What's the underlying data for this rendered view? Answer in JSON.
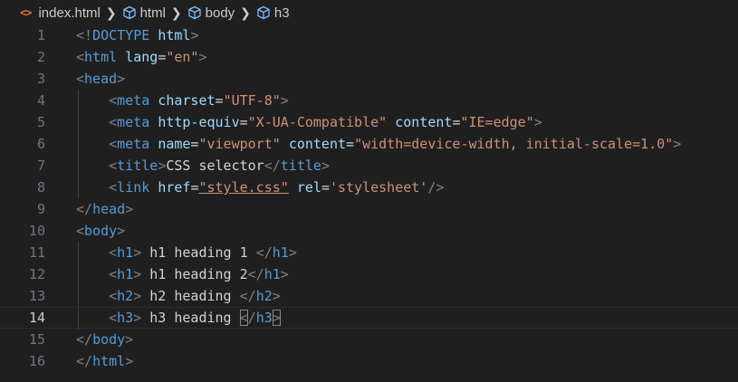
{
  "breadcrumb": {
    "file_icon": "<>",
    "file": "index.html",
    "items": [
      "html",
      "body",
      "h3"
    ]
  },
  "colors": {
    "background": "#1f1f1f",
    "tag": "#569cd6",
    "attribute": "#9cdcfe",
    "string": "#ce9178",
    "bracket": "#808080",
    "text": "#d4d4d4",
    "line_number": "#6e7681",
    "html_icon": "#e37933"
  },
  "icons": {
    "file": "html-file-icon",
    "symbol": "cube-icon",
    "separator": "chevron-right-icon"
  },
  "editor": {
    "current_line": 14,
    "lines": [
      {
        "n": "1",
        "indent": 0,
        "tokens": [
          [
            "b",
            "<!"
          ],
          [
            "tag",
            "DOCTYPE"
          ],
          [
            "t",
            " "
          ],
          [
            "attr",
            "html"
          ],
          [
            "b",
            ">"
          ]
        ]
      },
      {
        "n": "2",
        "indent": 0,
        "tokens": [
          [
            "b",
            "<"
          ],
          [
            "tag",
            "html"
          ],
          [
            "t",
            " "
          ],
          [
            "attr",
            "lang"
          ],
          [
            "t",
            "="
          ],
          [
            "str",
            "\"en\""
          ],
          [
            "b",
            ">"
          ]
        ]
      },
      {
        "n": "3",
        "indent": 0,
        "tokens": [
          [
            "b",
            "<"
          ],
          [
            "tag",
            "head"
          ],
          [
            "b",
            ">"
          ]
        ]
      },
      {
        "n": "4",
        "indent": 1,
        "tokens": [
          [
            "b",
            "<"
          ],
          [
            "tag",
            "meta"
          ],
          [
            "t",
            " "
          ],
          [
            "attr",
            "charset"
          ],
          [
            "t",
            "="
          ],
          [
            "str",
            "\"UTF-8\""
          ],
          [
            "b",
            ">"
          ]
        ]
      },
      {
        "n": "5",
        "indent": 1,
        "tokens": [
          [
            "b",
            "<"
          ],
          [
            "tag",
            "meta"
          ],
          [
            "t",
            " "
          ],
          [
            "attr",
            "http-equiv"
          ],
          [
            "t",
            "="
          ],
          [
            "str",
            "\"X-UA-Compatible\""
          ],
          [
            "t",
            " "
          ],
          [
            "attr",
            "content"
          ],
          [
            "t",
            "="
          ],
          [
            "str",
            "\"IE=edge\""
          ],
          [
            "b",
            ">"
          ]
        ]
      },
      {
        "n": "6",
        "indent": 1,
        "tokens": [
          [
            "b",
            "<"
          ],
          [
            "tag",
            "meta"
          ],
          [
            "t",
            " "
          ],
          [
            "attr",
            "name"
          ],
          [
            "t",
            "="
          ],
          [
            "str",
            "\"viewport\""
          ],
          [
            "t",
            " "
          ],
          [
            "attr",
            "content"
          ],
          [
            "t",
            "="
          ],
          [
            "str",
            "\"width=device-width, initial-scale=1.0\""
          ],
          [
            "b",
            ">"
          ]
        ]
      },
      {
        "n": "7",
        "indent": 1,
        "tokens": [
          [
            "b",
            "<"
          ],
          [
            "tag",
            "title"
          ],
          [
            "b",
            ">"
          ],
          [
            "t",
            "CSS selector"
          ],
          [
            "b",
            "</"
          ],
          [
            "tag",
            "title"
          ],
          [
            "b",
            ">"
          ]
        ]
      },
      {
        "n": "8",
        "indent": 1,
        "tokens": [
          [
            "b",
            "<"
          ],
          [
            "tag",
            "link"
          ],
          [
            "t",
            " "
          ],
          [
            "attr",
            "href"
          ],
          [
            "t",
            "="
          ],
          [
            "link",
            "\"style.css\""
          ],
          [
            "t",
            " "
          ],
          [
            "attr",
            "rel"
          ],
          [
            "t",
            "="
          ],
          [
            "str",
            "'stylesheet'"
          ],
          [
            "b",
            "/>"
          ]
        ]
      },
      {
        "n": "9",
        "indent": 0,
        "tokens": [
          [
            "b",
            "</"
          ],
          [
            "tag",
            "head"
          ],
          [
            "b",
            ">"
          ]
        ]
      },
      {
        "n": "10",
        "indent": 0,
        "tokens": [
          [
            "b",
            "<"
          ],
          [
            "tag",
            "body"
          ],
          [
            "b",
            ">"
          ]
        ]
      },
      {
        "n": "11",
        "indent": 1,
        "tokens": [
          [
            "b",
            "<"
          ],
          [
            "tag",
            "h1"
          ],
          [
            "b",
            ">"
          ],
          [
            "t",
            " h1 heading 1 "
          ],
          [
            "b",
            "</"
          ],
          [
            "tag",
            "h1"
          ],
          [
            "b",
            ">"
          ]
        ]
      },
      {
        "n": "12",
        "indent": 1,
        "tokens": [
          [
            "b",
            "<"
          ],
          [
            "tag",
            "h1"
          ],
          [
            "b",
            ">"
          ],
          [
            "t",
            " h1 heading 2"
          ],
          [
            "b",
            "</"
          ],
          [
            "tag",
            "h1"
          ],
          [
            "b",
            ">"
          ]
        ]
      },
      {
        "n": "13",
        "indent": 1,
        "tokens": [
          [
            "b",
            "<"
          ],
          [
            "tag",
            "h2"
          ],
          [
            "b",
            ">"
          ],
          [
            "t",
            " h2 heading "
          ],
          [
            "b",
            "</"
          ],
          [
            "tag",
            "h2"
          ],
          [
            "b",
            ">"
          ]
        ]
      },
      {
        "n": "14",
        "indent": 1,
        "tokens": [
          [
            "b",
            "<"
          ],
          [
            "tag",
            "h3"
          ],
          [
            "b",
            ">"
          ],
          [
            "t",
            " h3 heading "
          ],
          [
            "bm",
            "<"
          ],
          [
            "b",
            "/"
          ],
          [
            "tag",
            "h3"
          ],
          [
            "bm",
            ">"
          ]
        ]
      },
      {
        "n": "15",
        "indent": 0,
        "tokens": [
          [
            "b",
            "</"
          ],
          [
            "tag",
            "body"
          ],
          [
            "b",
            ">"
          ]
        ]
      },
      {
        "n": "16",
        "indent": 0,
        "tokens": [
          [
            "b",
            "</"
          ],
          [
            "tag",
            "html"
          ],
          [
            "b",
            ">"
          ]
        ]
      }
    ]
  }
}
